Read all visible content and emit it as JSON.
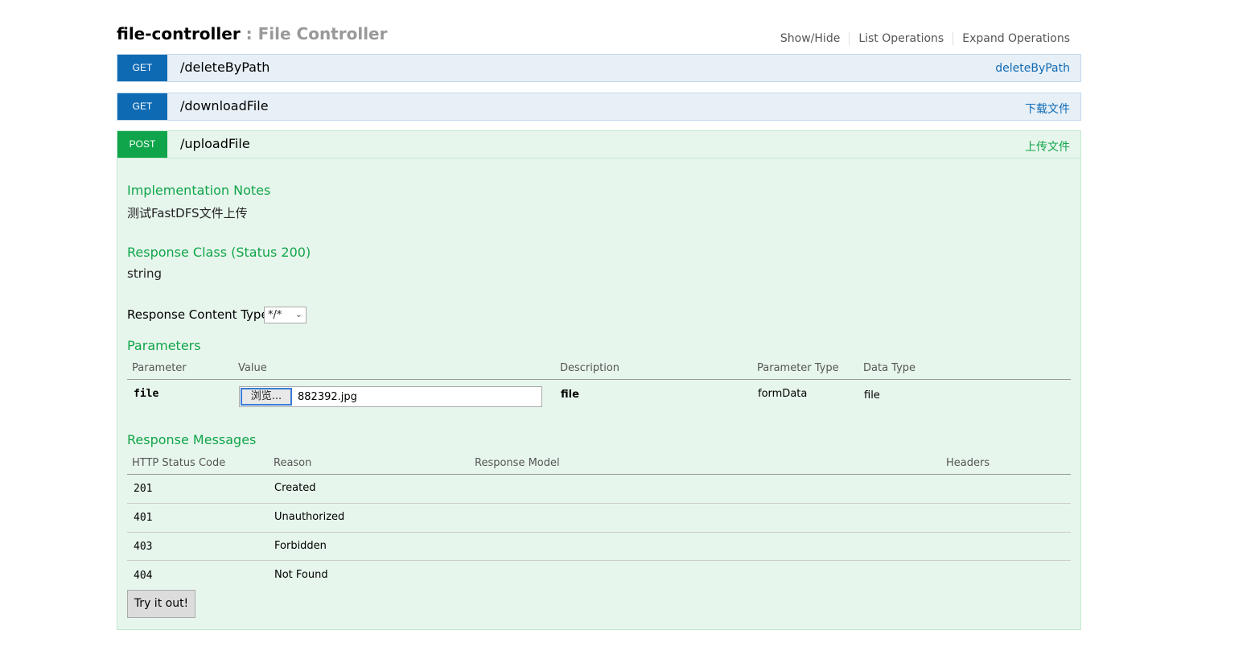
{
  "resource": {
    "name": "file-controller",
    "separator": " : ",
    "description": "File Controller",
    "ops": [
      "Show/Hide",
      "List Operations",
      "Expand Operations"
    ]
  },
  "operations": [
    {
      "method": "GET",
      "path": "/deleteByPath",
      "summary": "deleteByPath"
    },
    {
      "method": "GET",
      "path": "/downloadFile",
      "summary": "下载文件"
    },
    {
      "method": "POST",
      "path": "/uploadFile",
      "summary": "上传文件"
    }
  ],
  "upload": {
    "impl_title": "Implementation Notes",
    "impl_text": "测试FastDFS文件上传",
    "resp_class_title": "Response Class (Status 200)",
    "resp_class_text": "string",
    "content_type_label": "Response Content Type",
    "content_type_value": "*/*",
    "params_title": "Parameters",
    "params_headers": [
      "Parameter",
      "Value",
      "Description",
      "Parameter Type",
      "Data Type"
    ],
    "param": {
      "name": "file",
      "browse_label": "浏览...",
      "file_value": "882392.jpg",
      "description": "file",
      "param_type": "formData",
      "data_type": "file"
    },
    "messages_title": "Response Messages",
    "messages_headers": [
      "HTTP Status Code",
      "Reason",
      "Response Model",
      "Headers"
    ],
    "messages": [
      {
        "code": "201",
        "reason": "Created"
      },
      {
        "code": "401",
        "reason": "Unauthorized"
      },
      {
        "code": "403",
        "reason": "Forbidden"
      },
      {
        "code": "404",
        "reason": "Not Found"
      }
    ],
    "try_label": "Try it out!"
  },
  "colors": {
    "get": "#0f6ab4",
    "post": "#10a54a",
    "section_title": "#10a54a"
  },
  "icons": {
    "select_arrow": "chevron-down-icon"
  }
}
